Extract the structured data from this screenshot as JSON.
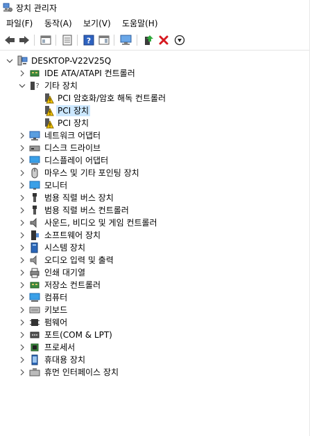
{
  "window": {
    "title": "장치 관리자"
  },
  "menu": {
    "file": "파일(F)",
    "action": "동작(A)",
    "view": "보기(V)",
    "help": "도움말(H)"
  },
  "toolbar": {
    "icons": [
      "back-icon",
      "forward-icon",
      "properties-pane-icon",
      "properties-icon",
      "help-icon",
      "action-pane-icon",
      "scan-hardware-icon",
      "update-driver-icon",
      "uninstall-icon",
      "disable-icon"
    ]
  },
  "tree": {
    "root": "DESKTOP-V22V25Q",
    "ide": "IDE ATA/ATAPI 컨트롤러",
    "other": "기타 장치",
    "other_children": [
      "PCI 암호화/암호 해독 컨트롤러",
      "PCI 장치",
      "PCI 장치"
    ],
    "selected_index": 1,
    "categories": [
      "네트워크 어댑터",
      "디스크 드라이브",
      "디스플레이 어댑터",
      "마우스 및 기타 포인팅 장치",
      "모니터",
      "범용 직렬 버스 장치",
      "범용 직렬 버스 컨트롤러",
      "사운드, 비디오 및 게임 컨트롤러",
      "소프트웨어 장치",
      "시스템 장치",
      "오디오 입력 및 출력",
      "인쇄 대기열",
      "저장소 컨트롤러",
      "컴퓨터",
      "키보드",
      "펌웨어",
      "포트(COM & LPT)",
      "프로세서",
      "휴대용 장치",
      "휴먼 인터페이스 장치"
    ],
    "category_icons": [
      "network-adapter-icon",
      "disk-drive-icon",
      "display-adapter-icon",
      "mouse-icon",
      "monitor-icon",
      "usb-device-icon",
      "usb-controller-icon",
      "sound-icon",
      "software-device-icon",
      "system-device-icon",
      "audio-io-icon",
      "print-queue-icon",
      "storage-controller-icon",
      "computer-icon",
      "keyboard-icon",
      "firmware-icon",
      "port-icon",
      "processor-icon",
      "portable-device-icon",
      "hid-icon"
    ]
  }
}
